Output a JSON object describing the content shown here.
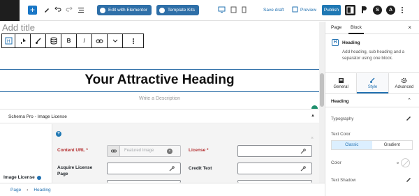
{
  "toolbar": {
    "edit_elementor": "Edit with Elementor",
    "template_kits": "Template Kits",
    "save_draft": "Save draft",
    "preview": "Preview",
    "publish": "Publish",
    "avatar_letter": "A"
  },
  "editor": {
    "title_placeholder": "Add title",
    "heading": "Your Attractive Heading",
    "description_placeholder": "Write a Description"
  },
  "schema": {
    "panel_title": "Schema Pro - Image License",
    "group_label": "Image License",
    "fields": {
      "content_url": "Content URL",
      "content_url_placeholder": "Featured Image",
      "license": "License",
      "acquire_license_page": "Acquire License Page",
      "credit_text": "Credit Text",
      "required_mark": "*"
    }
  },
  "breadcrumb": [
    "Page",
    "Heading"
  ],
  "sidebar": {
    "tabs": [
      "Page",
      "Block"
    ],
    "active_tab": "Block",
    "block": {
      "name": "Heading",
      "description": "Add heading, sub heading and a separator using one block.",
      "icon_letter": "H"
    },
    "style_tabs": [
      "General",
      "Style",
      "Advanced"
    ],
    "active_style_tab": "Style",
    "section": "Heading",
    "rows": {
      "typography": "Typography",
      "text_color": "Text Color",
      "classic": "Classic",
      "gradient": "Gradient",
      "color": "Color",
      "text_shadow": "Text Shadow"
    }
  },
  "colors": {
    "accent": "#2271b1",
    "publish": "#1f78b4",
    "required": "#b32d2e"
  }
}
